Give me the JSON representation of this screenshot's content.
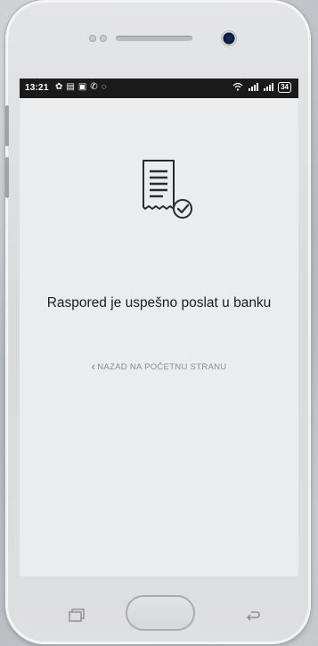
{
  "status_bar": {
    "time": "13:21",
    "left_icons": [
      "settings-icon",
      "message-icon",
      "youtube-icon",
      "call-icon",
      "viber-icon"
    ],
    "right_icons": [
      "wifi-icon",
      "signal-icon",
      "signal-icon"
    ],
    "battery": "34"
  },
  "content": {
    "message": "Raspored je uspešno poslat u banku",
    "back_link": "NAZAD NA POČETNU STRANU",
    "icon": "receipt-check-icon"
  },
  "nav_bar": {
    "icons": [
      "recent-apps-icon",
      "home-button",
      "back-icon"
    ]
  },
  "colors": {
    "screen_bg": "#ebecee",
    "status_bar_bg": "#1a1a1a",
    "message_text": "#1c1c1c",
    "link_text": "#8a8c90"
  }
}
